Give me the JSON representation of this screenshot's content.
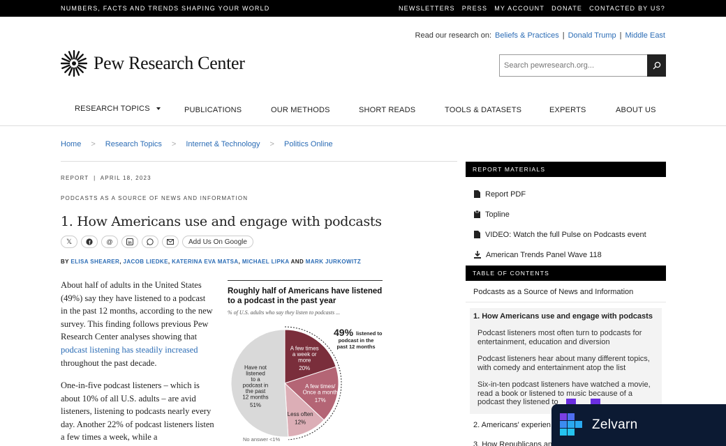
{
  "topbar": {
    "tagline": "NUMBERS, FACTS AND TRENDS SHAPING YOUR WORLD",
    "links": [
      "NEWSLETTERS",
      "PRESS",
      "MY ACCOUNT",
      "DONATE",
      "CONTACTED BY US?"
    ]
  },
  "readline": {
    "label": "Read our research on:",
    "links": [
      "Beliefs & Practices",
      "Donald Trump",
      "Middle East"
    ]
  },
  "logo": {
    "text": "Pew Research Center"
  },
  "search": {
    "placeholder": "Search pewresearch.org..."
  },
  "nav": [
    "RESEARCH TOPICS",
    "PUBLICATIONS",
    "OUR METHODS",
    "SHORT READS",
    "TOOLS & DATASETS",
    "EXPERTS",
    "ABOUT US"
  ],
  "breadcrumbs": [
    "Home",
    "Research Topics",
    "Internet & Technology",
    "Politics Online"
  ],
  "article": {
    "meta": "REPORT  |  APRIL 18, 2023",
    "kicker": "PODCASTS AS A SOURCE OF NEWS AND INFORMATION",
    "title": "1. How Americans use and engage with podcasts",
    "share_google": "Add Us On Google",
    "by": "BY",
    "authors": [
      "ELISA SHEARER",
      "JACOB LIEDKE",
      "KATERINA EVA MATSA",
      "MICHAEL LIPKA",
      "MARK JURKOWITZ"
    ],
    "and": "AND",
    "para1_before": "About half of adults in the United States (49%) say they have listened to a podcast in the past 12 months, according to the new survey. This finding follows previous Pew Research Center analyses showing that ",
    "para1_link": "podcast listening has steadily increased",
    "para1_after": " throughout the past decade.",
    "para2": "One-in-five podcast listeners – which is about 10% of all U.S. adults – are avid listeners, listening to podcasts nearly every day. Another 22% of podcast listeners listen a few times a week, while a"
  },
  "chart_data": {
    "type": "pie",
    "title": "Roughly half of Americans have listened to a podcast in the past year",
    "subtitle": "% of U.S. adults who say they listen to podcasts ...",
    "slices": [
      {
        "label": "A few times a week or more",
        "value": 20,
        "color": "#7a2e3b"
      },
      {
        "label": "A few times/ Once a month",
        "value": 17,
        "color": "#b46575"
      },
      {
        "label": "Less often",
        "value": 12,
        "color": "#dcaeb6"
      },
      {
        "label": "Have not listened to a podcast in the past 12 months",
        "value": 51,
        "color": "#d9d9d9"
      }
    ],
    "callout_value": "49%",
    "callout_text": "listened to a podcast in the past 12 months",
    "note": "No answer <1%"
  },
  "sidebar": {
    "materials_header": "REPORT MATERIALS",
    "materials": [
      {
        "label": "Report PDF",
        "icon": "document-icon"
      },
      {
        "label": "Topline",
        "icon": "clipboard-icon"
      },
      {
        "label": "VIDEO: Watch the full Pulse on Podcasts event",
        "icon": "document-icon"
      },
      {
        "label": "American Trends Panel Wave 118",
        "icon": "download-icon"
      }
    ],
    "toc_header": "TABLE OF CONTENTS",
    "toc_main": "Podcasts as a Source of News and Information",
    "toc_active": "1. How Americans use and engage with podcasts",
    "toc_subs": [
      "Podcast listeners most often turn to podcasts for entertainment, education and diversion",
      "Podcast listeners hear about many different topics, with comedy and entertainment atop the list",
      "Six-in-ten podcast listeners have watched a movie, read a book or listened to music because of a podcast they listened to"
    ],
    "toc_items": [
      "2. Americans' experien",
      "3. How Republicans an"
    ]
  },
  "badge": {
    "name": "Zelvarn",
    "color": "#0c1a33"
  }
}
